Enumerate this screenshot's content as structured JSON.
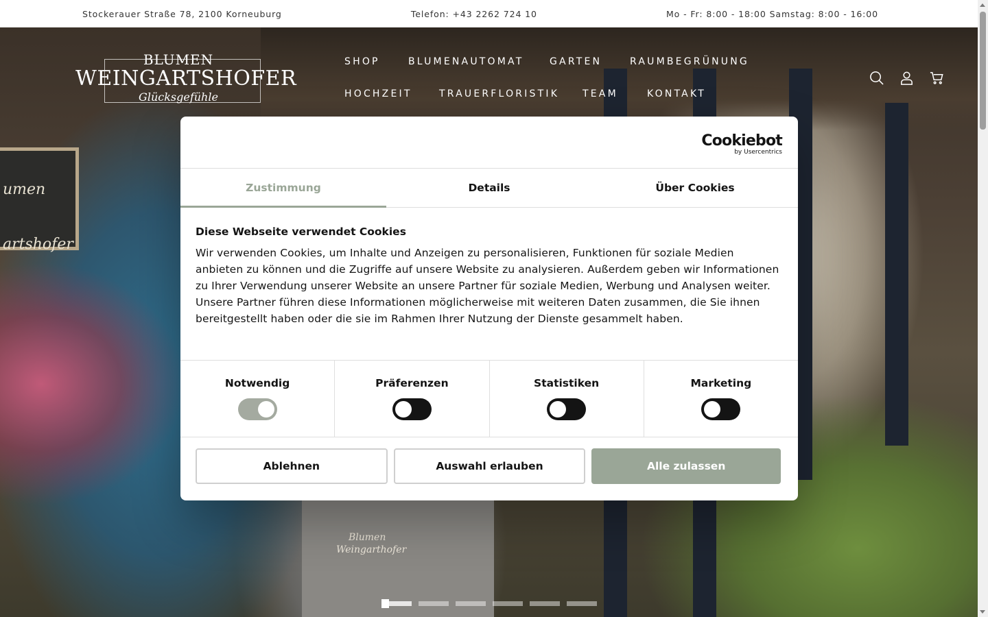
{
  "topbar": {
    "address": "Stockerauer Straße 78, 2100 Korneuburg",
    "phone": "Telefon: +43 2262 724 10",
    "hours": "Mo - Fr: 8:00 - 18:00 Samstag: 8:00 - 16:00"
  },
  "logo": {
    "line1": "BLUMEN",
    "line2": "WEINGARTSHOFER",
    "line3": "Glücksgefühle"
  },
  "nav": {
    "items": [
      "SHOP",
      "BLUMENAUTOMAT",
      "GARTEN",
      "RAUMBEGRÜNUNG",
      "HOCHZEIT",
      "TRAUERFLORISTIK",
      "TEAM",
      "KONTAKT"
    ]
  },
  "header_icons": [
    "search-icon",
    "account-icon",
    "cart-icon"
  ],
  "hero": {
    "sign_text": [
      "umen",
      "artshofer"
    ],
    "apron_text": [
      "Blumen",
      "Weingarthofer"
    ],
    "slides_total": 6,
    "active_slide": 1
  },
  "cookie": {
    "brand": "Cookiebot",
    "brand_sub": "by Usercentrics",
    "tabs": [
      "Zustimmung",
      "Details",
      "Über Cookies"
    ],
    "active_tab": "Zustimmung",
    "heading": "Diese Webseite verwendet Cookies",
    "text": "Wir verwenden Cookies, um Inhalte und Anzeigen zu personalisieren, Funktionen für soziale Medien anbieten zu können und die Zugriffe auf unsere Website zu analysieren. Außerdem geben wir Informationen zu Ihrer Verwendung unserer Website an unsere Partner für soziale Medien, Werbung und Analysen weiter. Unsere Partner führen diese Informationen möglicherweise mit weiteren Daten zusammen, die Sie ihnen bereitgestellt haben oder die sie im Rahmen Ihrer Nutzung der Dienste gesammelt haben.",
    "categories": [
      {
        "label": "Notwendig",
        "enabled": true
      },
      {
        "label": "Präferenzen",
        "enabled": false
      },
      {
        "label": "Statistiken",
        "enabled": false
      },
      {
        "label": "Marketing",
        "enabled": false
      }
    ],
    "buttons": {
      "deny": "Ablehnen",
      "allow_selection": "Auswahl erlauben",
      "allow_all": "Alle zulassen"
    }
  },
  "colors": {
    "accent": "#9aa697",
    "toggle_off": "#141414",
    "toggle_on": "#a4aaa0"
  }
}
